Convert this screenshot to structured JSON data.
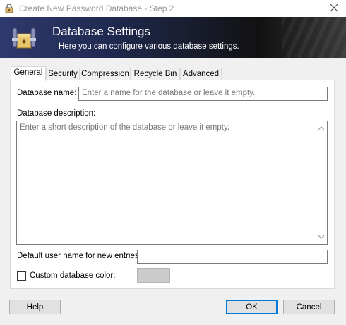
{
  "window": {
    "title": "Create New Password Database - Step 2",
    "title_icon": "keepass-lock-icon",
    "close_icon": "close-icon"
  },
  "banner": {
    "title": "Database Settings",
    "subtitle": "Here you can configure various database settings.",
    "icon": "database-settings-icon"
  },
  "tabs": [
    {
      "label": "General",
      "active": true
    },
    {
      "label": "Security",
      "active": false
    },
    {
      "label": "Compression",
      "active": false
    },
    {
      "label": "Recycle Bin",
      "active": false
    },
    {
      "label": "Advanced",
      "active": false
    }
  ],
  "general": {
    "name_label": "Database name:",
    "name_value": "",
    "name_placeholder": "Enter a name for the database or leave it empty.",
    "description_label": "Database description:",
    "description_value": "",
    "description_placeholder": "Enter a short description of the database or leave it empty.",
    "default_user_label": "Default user name for new entries:",
    "default_user_value": "",
    "custom_color_label": "Custom database color:",
    "custom_color_checked": false,
    "custom_color_value": "#cccccc"
  },
  "buttons": {
    "help": "Help",
    "ok": "OK",
    "cancel": "Cancel"
  },
  "colors": {
    "accent": "#0078d7",
    "banner_left": "#2f3a6e",
    "banner_right": "#121212"
  }
}
